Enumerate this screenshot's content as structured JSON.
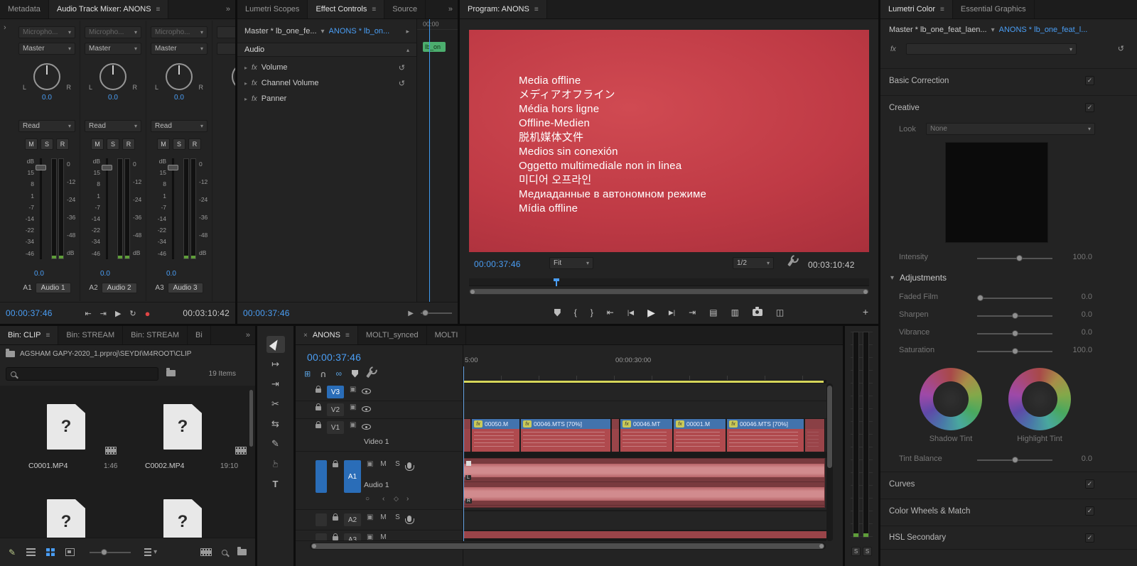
{
  "glyphs": {
    "menu": "≡",
    "overflow": "»",
    "chevron_down": "▾",
    "chevron_right": "›",
    "disclosure": "▸",
    "collapse_up": "▴",
    "reset": "↺",
    "loop": "↻",
    "go_to_in": "⇤",
    "go_to_out": "⇥",
    "play": "▶",
    "step_back": "|◀",
    "step_forward": "▶|",
    "record": "●",
    "mark_in": "{",
    "mark_out": "}",
    "lift": "▤",
    "extract": "▥",
    "compare": "◫",
    "plus": "+",
    "close": "×",
    "linked": "∞",
    "nest": "⊞",
    "snap": "U",
    "sync_lock": "▣",
    "check": "✓",
    "track_select": "↦",
    "ripple_edit": "⇥",
    "razor": "✂",
    "slip": "⇆",
    "pen": "✎",
    "hand": "☞",
    "type": "T",
    "keyframe_prev": "‹",
    "keyframe_add": "◇",
    "keyframe_next": "›",
    "keyframe_circle": "○",
    "doc_question": "?"
  },
  "colors": {
    "accent_blue": "#4a9ef5",
    "record_red": "#e04545",
    "selected_clip_bar": "#4273ad",
    "clip_body_red": "#b04a4e",
    "audio_clip_red": "#793a3e",
    "chip_green": "#4cae6e",
    "work_bar_yellow": "#d6d65a",
    "track_target_blue": "#2a6db8",
    "offline_screen_red": "#c03a45"
  },
  "mixer": {
    "tabs": [
      {
        "label": "Metadata"
      },
      {
        "label": "Audio Track Mixer: ANONS"
      }
    ],
    "pan_left": "L",
    "pan_right": "R",
    "msr": [
      "M",
      "S",
      "R"
    ],
    "fader_scale": "dB\n15\n8\n1\n-7\n-14\n-22\n-34\n-46",
    "meter_scale": "0\n-12\n-24\n-36\n-48\ndB",
    "channels": [
      {
        "input": "Micropho...",
        "output": "Master",
        "pan_value": "0.0",
        "automation": "Read",
        "fader_value": "0.0",
        "track_id": "A1",
        "track_name": "Audio 1"
      },
      {
        "input": "Micropho...",
        "output": "Master",
        "pan_value": "0.0",
        "automation": "Read",
        "fader_value": "0.0",
        "track_id": "A2",
        "track_name": "Audio 2"
      },
      {
        "input": "Micropho...",
        "output": "Master",
        "pan_value": "0.0",
        "automation": "Read",
        "fader_value": "0.0",
        "track_id": "A3",
        "track_name": "Audio 3"
      }
    ],
    "timecode": "00:00:37:46",
    "duration": "00:03:10:42"
  },
  "effects": {
    "tabs": [
      {
        "label": "Lumetri Scopes"
      },
      {
        "label": "Effect Controls"
      },
      {
        "label": "Source"
      }
    ],
    "master_ref": "Master * lb_one_fe...",
    "clip_ref": "ANONS * lb_on...",
    "ruler_start": "00:00",
    "clip_chip": "lb_on",
    "section": "Audio",
    "fx_label": "fx",
    "rows": [
      {
        "name": "Volume"
      },
      {
        "name": "Channel Volume"
      },
      {
        "name": "Panner"
      }
    ],
    "timecode": "00:00:37:46"
  },
  "program": {
    "tab": "Program: ANONS",
    "offline_text": "Media offline\nメディアオフライン\nMédia hors ligne\nOffline-Medien\n脱机媒体文件\nMedios sin conexión\nOggetto multimediale non in linea\n미디어 오프라인\nМедиаданные в автономном режиме\nMídia offline",
    "timecode": "00:00:37:46",
    "zoom_level": "Fit",
    "playback_resolution": "1/2",
    "duration": "00:03:10:42"
  },
  "lumetri": {
    "tabs": [
      {
        "label": "Lumetri Color"
      },
      {
        "label": "Essential Graphics"
      }
    ],
    "master_ref": "Master * lb_one_feat_laen...",
    "clip_ref": "ANONS * lb_one_feat_l...",
    "fx_label": "fx",
    "sections": {
      "basic": "Basic Correction",
      "creative": "Creative",
      "curves": "Curves",
      "wheels_match": "Color Wheels & Match",
      "hsl": "HSL Secondary"
    },
    "look_label": "Look",
    "look_value": "None",
    "intensity": {
      "label": "Intensity",
      "value": "100.0"
    },
    "adjustments_label": "Adjustments",
    "sliders": [
      {
        "label": "Faded Film",
        "value": "0.0"
      },
      {
        "label": "Sharpen",
        "value": "0.0"
      },
      {
        "label": "Vibrance",
        "value": "0.0"
      },
      {
        "label": "Saturation",
        "value": "100.0"
      }
    ],
    "wheels": [
      {
        "label": "Shadow Tint"
      },
      {
        "label": "Highlight Tint"
      }
    ],
    "tint_balance": {
      "label": "Tint Balance",
      "value": "0.0"
    }
  },
  "project": {
    "tabs": [
      {
        "label": "Bin: CLIP"
      },
      {
        "label": "Bin: STREAM"
      },
      {
        "label": "Bin: STREAM"
      },
      {
        "label": "Bi"
      }
    ],
    "path": "AGSHAM GAPY-2020_1.prproj\\SEYDI\\M4ROOT\\CLIP",
    "items_count": "19 Items",
    "clips": [
      {
        "name": "C0001.MP4",
        "duration": "1:46"
      },
      {
        "name": "C0002.MP4",
        "duration": "19:10"
      }
    ]
  },
  "timeline": {
    "tabs": [
      {
        "label": "ANONS"
      },
      {
        "label": "MOLTI_synced"
      },
      {
        "label": "MOLTI"
      }
    ],
    "timecode": "00:00:37:46",
    "ruler_labels": [
      "5:00",
      "00:00:30:00"
    ],
    "video_tracks": [
      {
        "id": "V3"
      },
      {
        "id": "V2"
      },
      {
        "id": "V1",
        "name": "Video 1"
      }
    ],
    "audio_tracks": [
      {
        "id": "A1",
        "name": "Audio 1"
      },
      {
        "id": "A2"
      },
      {
        "id": "A3"
      }
    ],
    "mute": "M",
    "solo": "S",
    "fx_badge": "fx",
    "clips": [
      {
        "label": "00050.M"
      },
      {
        "label": "00046.MTS [70%]"
      },
      {
        "label": "00046.MT"
      },
      {
        "label": "00001.M"
      },
      {
        "label": "00046.MTS [70%]"
      }
    ],
    "audio_channels": [
      "L",
      "R"
    ]
  },
  "meters": {
    "solo": "S"
  }
}
